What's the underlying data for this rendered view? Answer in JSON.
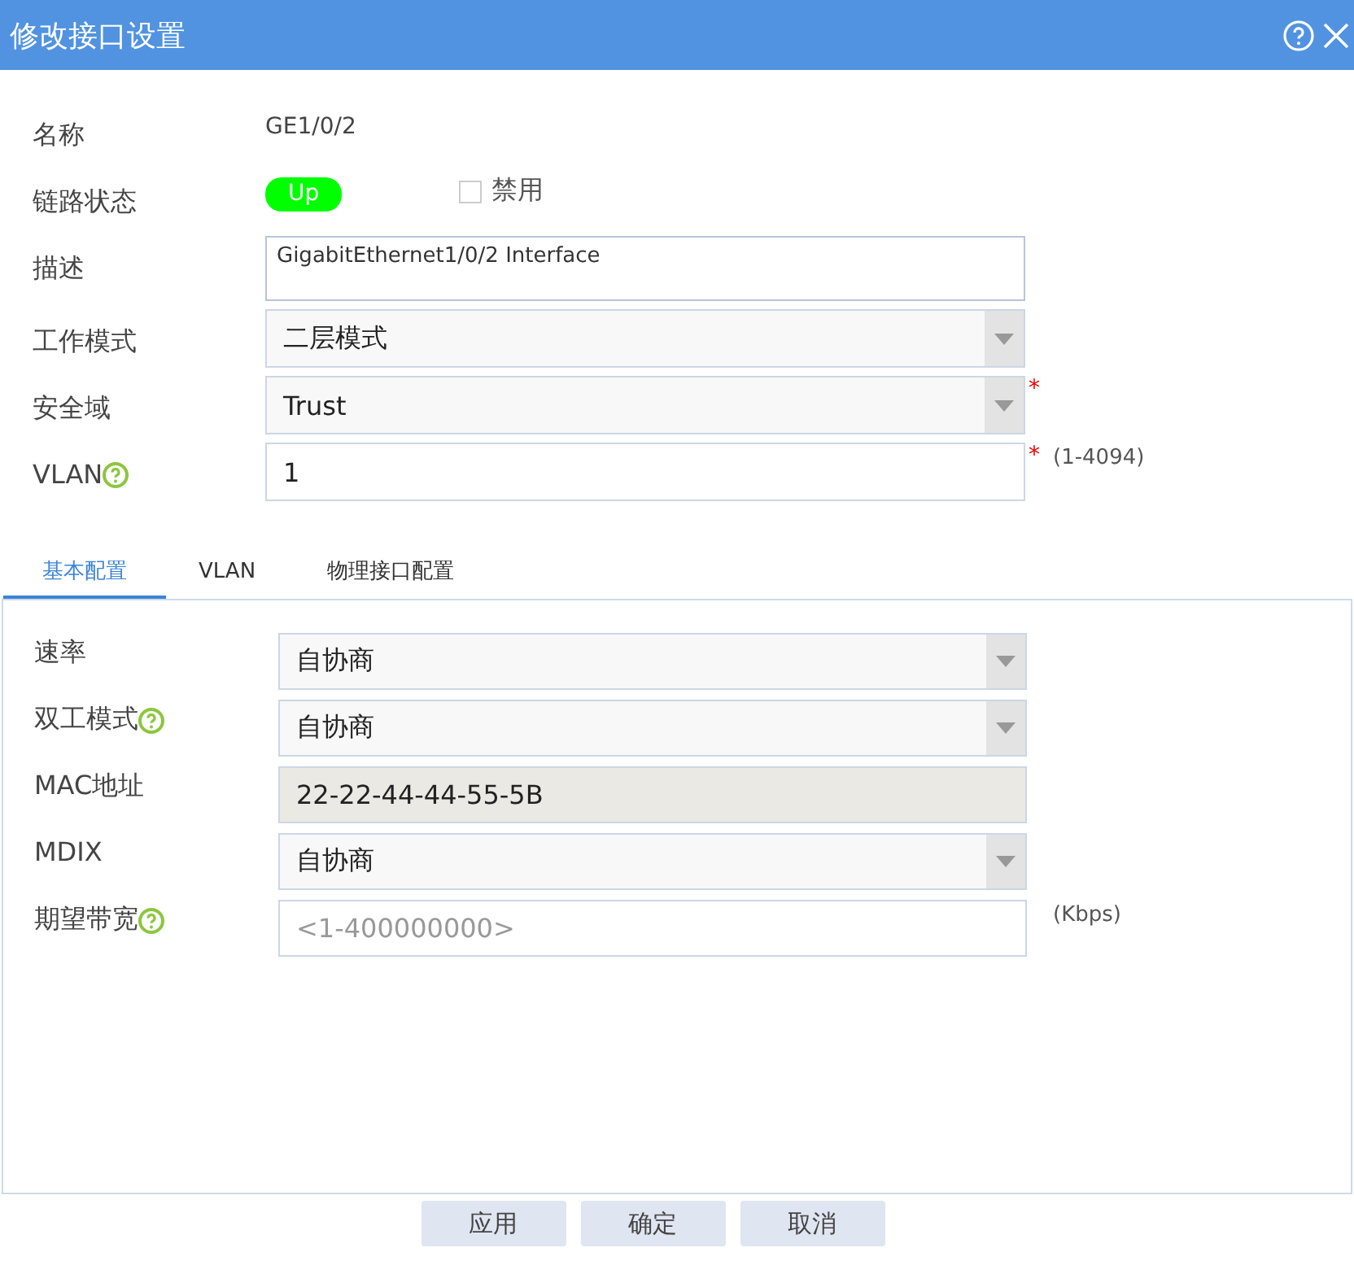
{
  "window": {
    "title": "修改接口设置"
  },
  "form": [
    {
      "kind": "static",
      "label": "名称",
      "value": "GE1/0/2"
    },
    {
      "kind": "status",
      "label": "链路状态",
      "value": "Up",
      "checkbox": {
        "label": "禁用",
        "checked": false
      }
    },
    {
      "kind": "textarea",
      "label": "描述",
      "value": "GigabitEthernet1/0/2 Interface"
    },
    {
      "kind": "select",
      "label": "工作模式",
      "value": "二层模式"
    },
    {
      "kind": "select",
      "label": "安全域",
      "value": "Trust",
      "required_mark": "*"
    },
    {
      "kind": "text",
      "label": "VLAN",
      "help": true,
      "value": "1",
      "required_mark": "*",
      "hint": "(1-4094)"
    }
  ],
  "tabs": [
    {
      "label": "基本配置",
      "selected": true
    },
    {
      "label": "VLAN",
      "selected": false
    },
    {
      "label": "物理接口配置",
      "selected": false
    }
  ],
  "panel": [
    {
      "kind": "select",
      "label": "速率",
      "value": "自协商"
    },
    {
      "kind": "select",
      "label": "双工模式",
      "help": true,
      "value": "自协商"
    },
    {
      "kind": "readonly",
      "label": "MAC地址",
      "value": "22-22-44-44-55-5B"
    },
    {
      "kind": "select",
      "label": "MDIX",
      "value": "自协商"
    },
    {
      "kind": "text",
      "label": "期望带宽",
      "help": true,
      "placeholder": "<1-400000000>",
      "hint": "(Kbps)"
    }
  ],
  "buttons": [
    "应用",
    "确定",
    "取消"
  ]
}
